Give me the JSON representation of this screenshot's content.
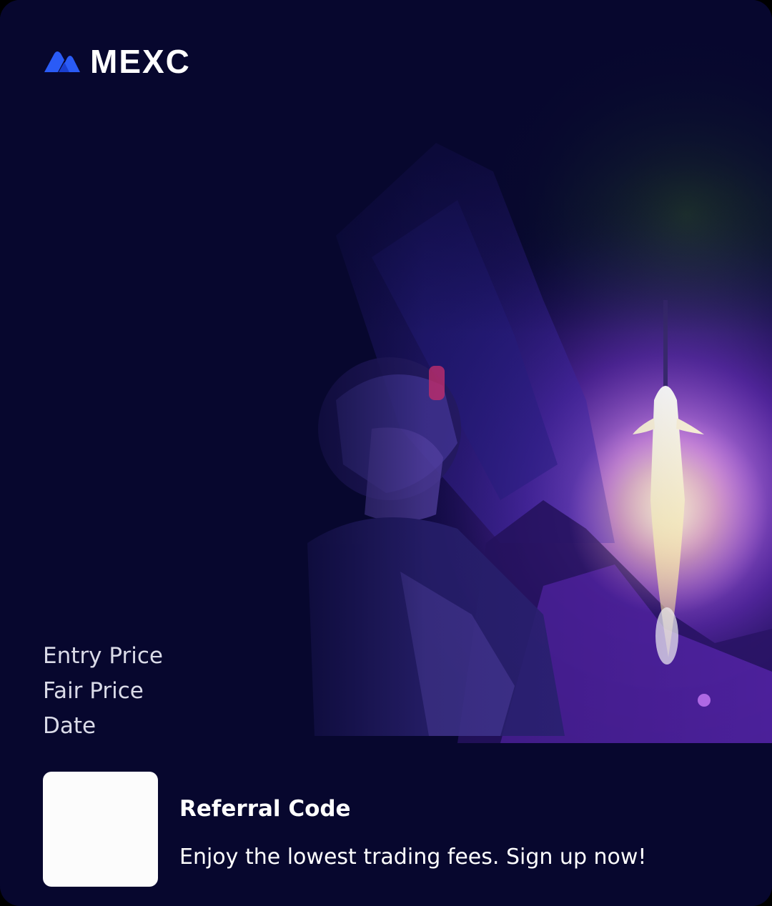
{
  "brand": {
    "name": "MEXC",
    "accent": "#2a5bf6"
  },
  "stats": [
    {
      "label": "Entry Price",
      "value": ""
    },
    {
      "label": "Fair Price",
      "value": ""
    },
    {
      "label": "Date",
      "value": ""
    }
  ],
  "referral": {
    "title": "Referral Code",
    "tagline": "Enjoy the lowest trading fees. Sign up now!"
  },
  "icons": {
    "logo": "mexc-logo-icon",
    "qr": "qr-code-icon"
  },
  "colors": {
    "background": "#07072e",
    "glow": "#b070ff",
    "rocket": "#fff6dc"
  }
}
